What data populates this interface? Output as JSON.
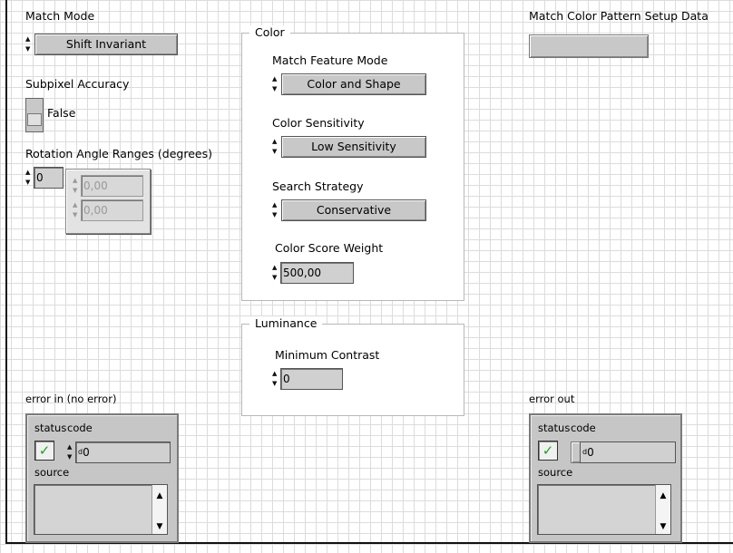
{
  "match_mode": {
    "label": "Match Mode",
    "value": "Shift Invariant"
  },
  "subpixel_accuracy": {
    "label": "Subpixel Accuracy",
    "value": "False"
  },
  "rotation": {
    "label": "Rotation Angle Ranges (degrees)",
    "index": "0",
    "elements": [
      "0,00",
      "0,00"
    ]
  },
  "color_group": {
    "title": "Color",
    "match_feature_mode": {
      "label": "Match Feature Mode",
      "value": "Color and Shape"
    },
    "color_sensitivity": {
      "label": "Color Sensitivity",
      "value": "Low Sensitivity"
    },
    "search_strategy": {
      "label": "Search Strategy",
      "value": "Conservative"
    },
    "color_score_weight": {
      "label": "Color Score Weight",
      "value": "500,00"
    }
  },
  "luminance_group": {
    "title": "Luminance",
    "minimum_contrast": {
      "label": "Minimum Contrast",
      "value": "0"
    }
  },
  "setup_data": {
    "label": "Match Color Pattern Setup Data",
    "value": ""
  },
  "error_in": {
    "label": "error in (no error)",
    "status_label": "status",
    "code_label": "code",
    "code_value": "0",
    "code_radix": "d",
    "source_label": "source",
    "source_value": ""
  },
  "error_out": {
    "label": "error out",
    "status_label": "status",
    "code_label": "code",
    "code_value": "0",
    "code_radix": "d",
    "source_label": "source",
    "source_value": ""
  },
  "icons": {
    "increment": "up-arrow-icon",
    "decrement": "down-arrow-icon",
    "status_ok": "checkmark-icon"
  },
  "colors": {
    "status_ok": "#1aa51a",
    "grid": "#dcdcdc",
    "control_face": "#c8c8c8"
  }
}
